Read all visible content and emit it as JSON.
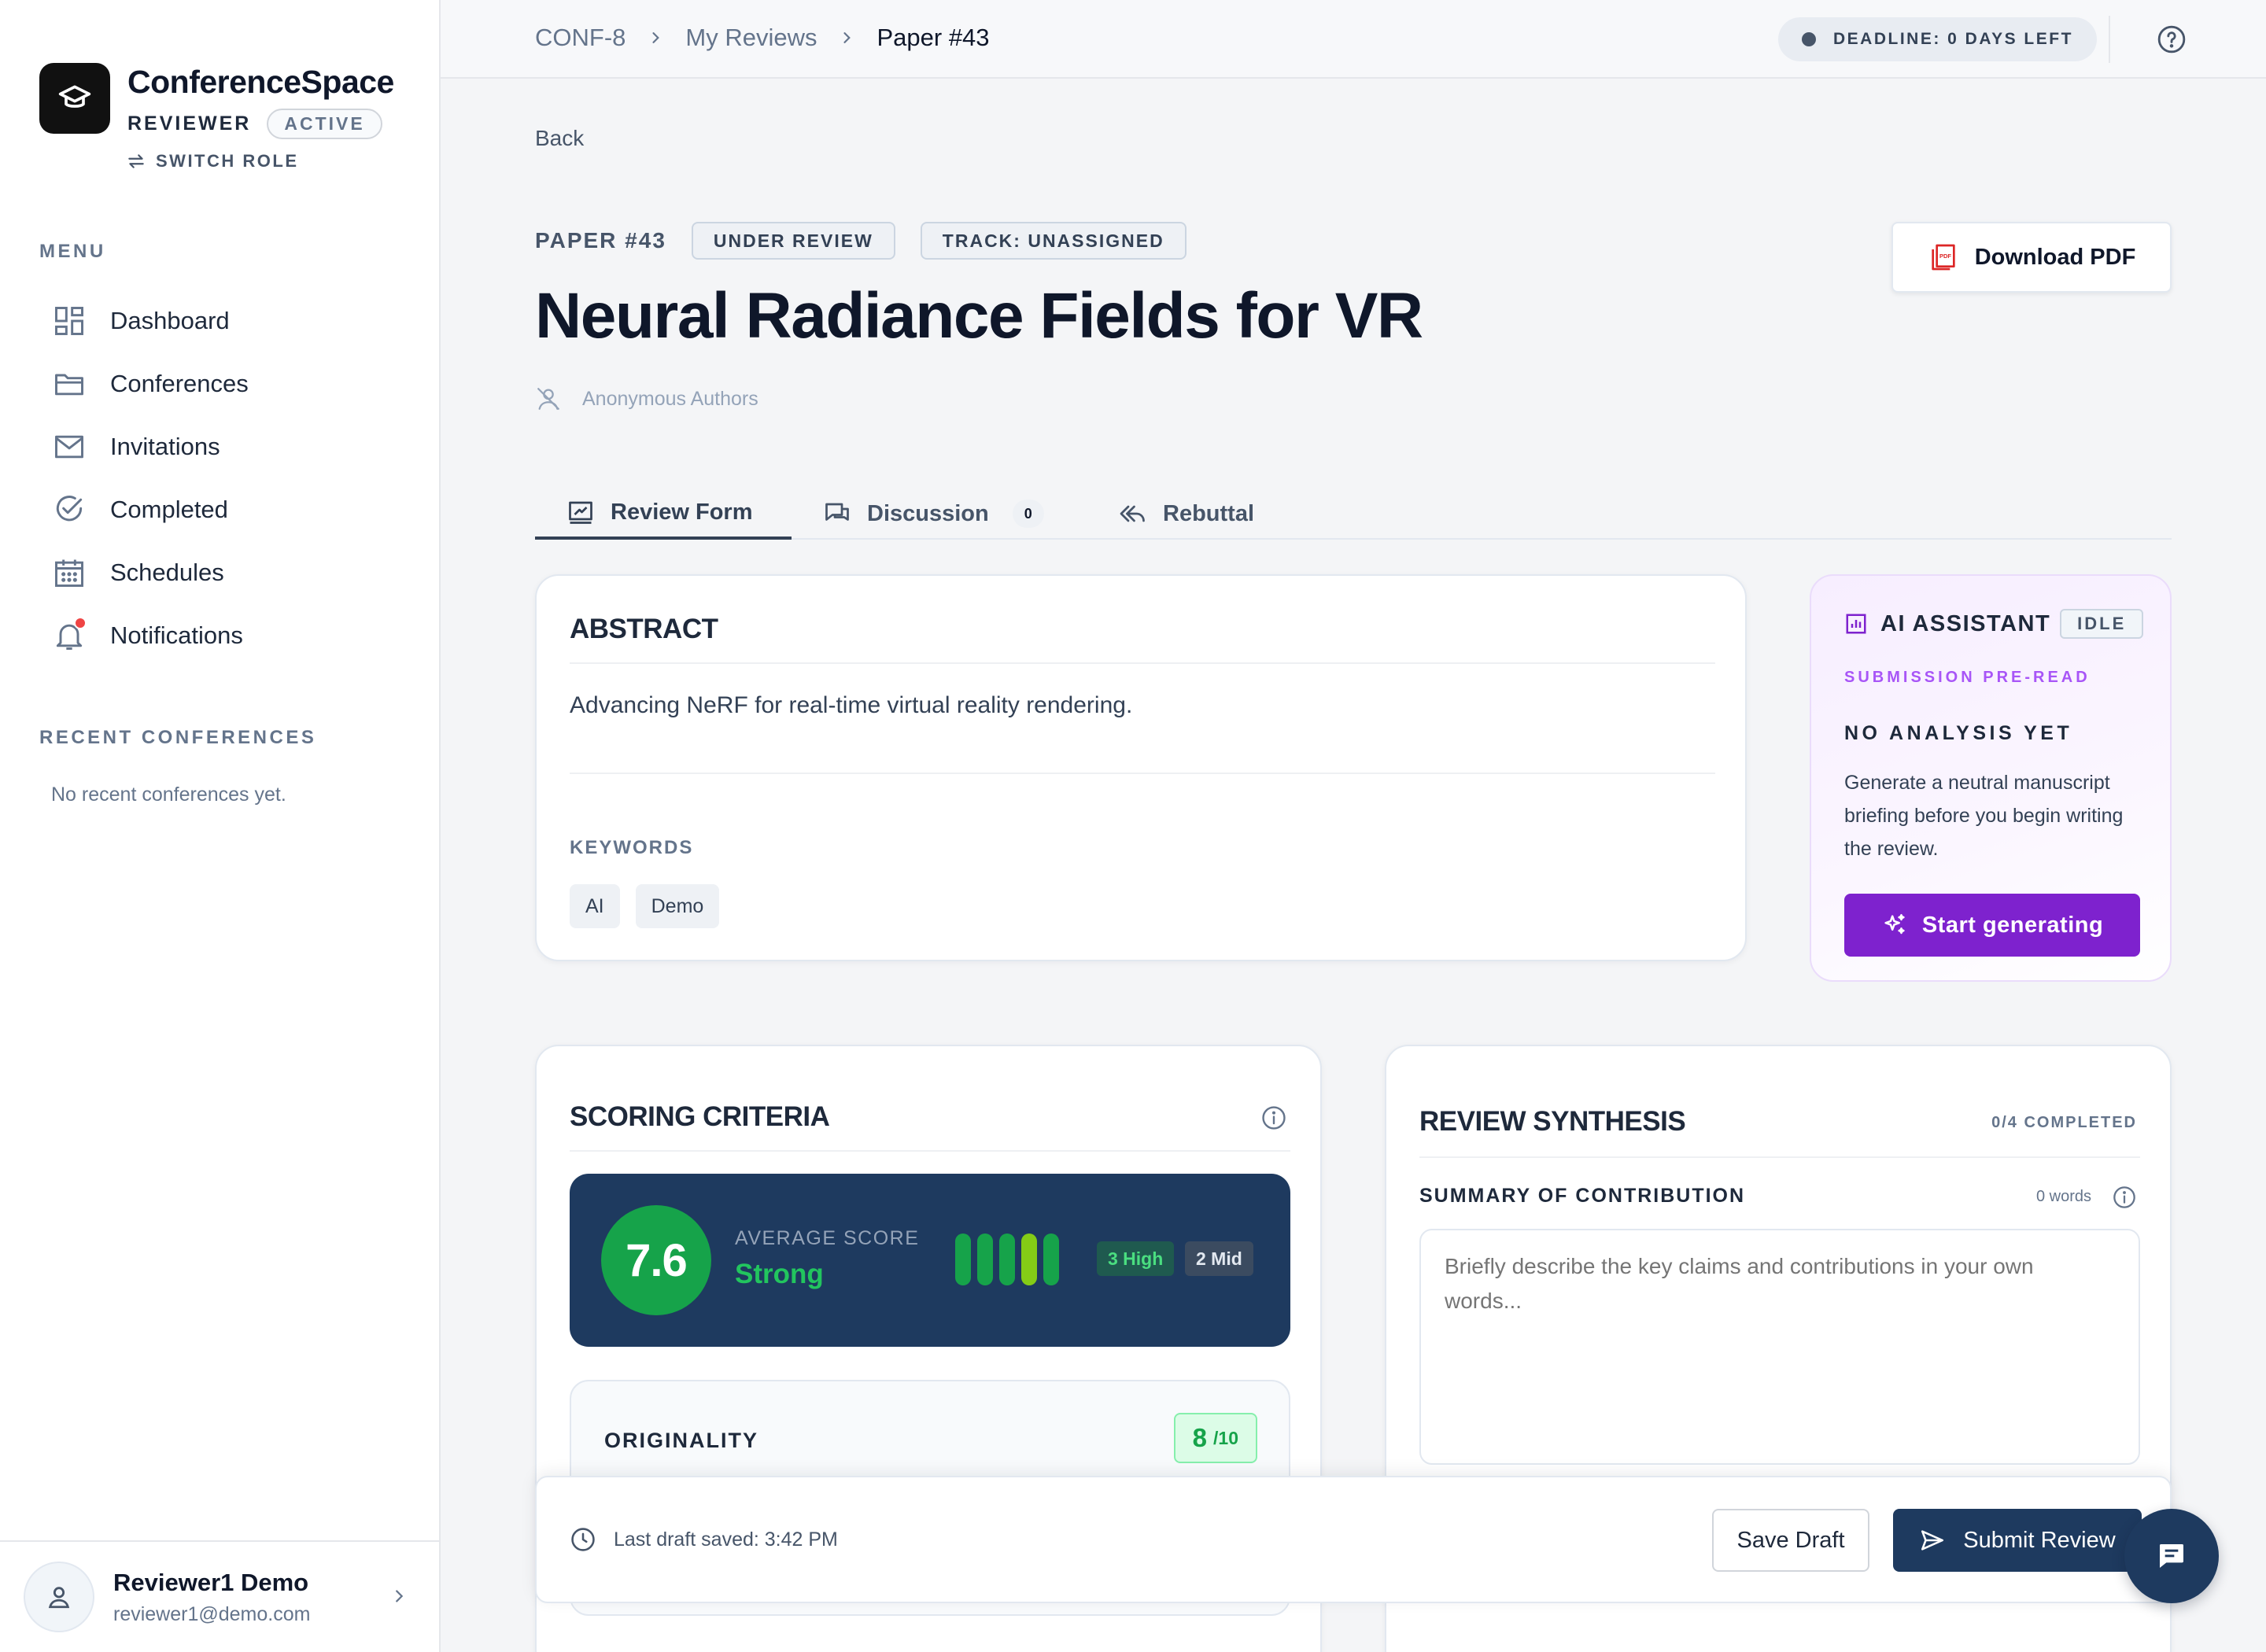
{
  "brand": {
    "name": "ConferenceSpace",
    "role": "REVIEWER",
    "role_status": "ACTIVE",
    "switch_role": "SWITCH ROLE",
    "logo_icon": "graduation-cap-icon"
  },
  "sidebar": {
    "menu_label": "MENU",
    "items": [
      {
        "label": "Dashboard",
        "icon": "dashboard-icon"
      },
      {
        "label": "Conferences",
        "icon": "folder-icon"
      },
      {
        "label": "Invitations",
        "icon": "mail-icon"
      },
      {
        "label": "Completed",
        "icon": "check-circle-icon"
      },
      {
        "label": "Schedules",
        "icon": "calendar-icon"
      },
      {
        "label": "Notifications",
        "icon": "bell-icon",
        "has_alert": true
      }
    ],
    "recent_label": "RECENT CONFERENCES",
    "recent_empty": "No recent conferences yet."
  },
  "user": {
    "name": "Reviewer1 Demo",
    "email": "reviewer1@demo.com"
  },
  "topbar": {
    "breadcrumb": [
      "CONF-8",
      "My Reviews",
      "Paper #43"
    ],
    "deadline": "DEADLINE: 0 DAYS LEFT"
  },
  "paper": {
    "back": "Back",
    "id": "PAPER #43",
    "status": "UNDER REVIEW",
    "track": "TRACK: UNASSIGNED",
    "title": "Neural Radiance Fields for VR",
    "authors": "Anonymous Authors",
    "download": "Download PDF"
  },
  "tabs": [
    {
      "label": "Review Form",
      "icon": "review-form-icon",
      "active": true
    },
    {
      "label": "Discussion",
      "icon": "chat-bubbles-icon",
      "count": "0"
    },
    {
      "label": "Rebuttal",
      "icon": "reply-all-icon"
    }
  ],
  "abstract": {
    "title": "ABSTRACT",
    "text": "Advancing NeRF for real-time virtual reality rendering.",
    "keywords_label": "KEYWORDS",
    "keywords": [
      "AI",
      "Demo"
    ]
  },
  "ai_assistant": {
    "title": "AI ASSISTANT",
    "status": "IDLE",
    "subtitle": "SUBMISSION PRE-READ",
    "empty_title": "NO ANALYSIS YET",
    "description": "Generate a neutral manuscript briefing before you begin writing the review.",
    "button": "Start generating",
    "accent": "#7e22ce"
  },
  "scoring": {
    "title": "SCORING CRITERIA",
    "average_label": "AVERAGE SCORE",
    "average": "7.6",
    "verdict": "Strong",
    "bar_colors": [
      "#16a34a",
      "#16a34a",
      "#16a34a",
      "#84cc16",
      "#16a34a"
    ],
    "high": "3 High",
    "mid": "2 Mid",
    "criteria": [
      {
        "name": "ORIGINALITY",
        "score": "8",
        "max": "/10"
      }
    ]
  },
  "synthesis": {
    "title": "REVIEW SYNTHESIS",
    "progress": "0/4 COMPLETED",
    "field_label": "SUMMARY OF CONTRIBUTION",
    "word_count": "0 words",
    "placeholder": "Briefly describe the key claims and contributions in your own words..."
  },
  "footer": {
    "draft_status": "Last draft saved: 3:42 PM",
    "save": "Save Draft",
    "submit": "Submit Review"
  },
  "colors": {
    "primary_dark": "#1e3a5f",
    "success": "#16a34a",
    "alert": "#ef4444"
  }
}
